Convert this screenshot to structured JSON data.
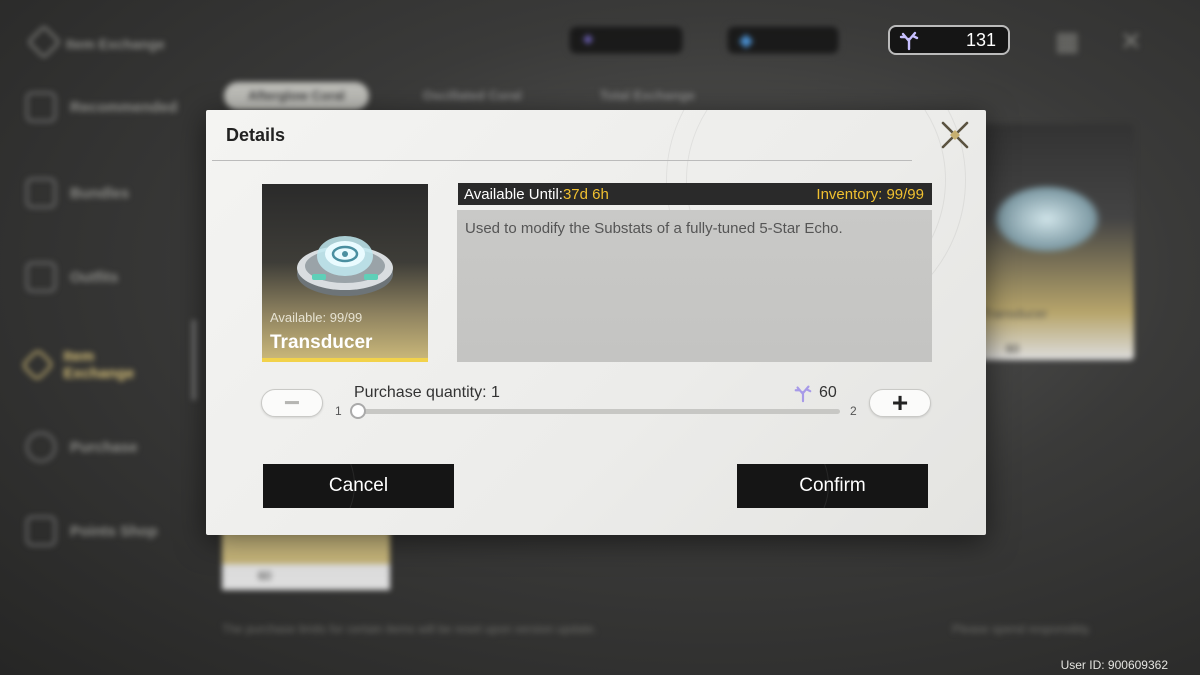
{
  "background": {
    "title": "Item Exchange",
    "sidebar": [
      {
        "label": "Recommended"
      },
      {
        "label": "Bundles"
      },
      {
        "label": "Outfits"
      },
      {
        "label": "Item Exchange"
      },
      {
        "label": "Purchase"
      },
      {
        "label": "Points Shop"
      }
    ],
    "tabs": [
      "Afterglow Coral",
      "Oscillated Coral",
      "Total Exchange"
    ],
    "currencies": [
      {
        "value": "131",
        "icon": "afterglow-coral-icon"
      }
    ],
    "card_left_price": "60",
    "card_right_label": "Transducer",
    "card_right_price": "60",
    "footnote_left": "The purchase limits for certain items will be reset upon version update.",
    "footnote_right": "Please spend responsibly."
  },
  "modal": {
    "title": "Details",
    "item": {
      "available": "Available: 99/99",
      "name": "Transducer"
    },
    "available_until_label": "Available Until:",
    "available_until_value": "37d 6h",
    "inventory_label": "Inventory:",
    "inventory_value": "99/99",
    "description": "Used to modify the Substats of a fully-tuned 5-Star Echo.",
    "quantity_label": "Purchase quantity: 1",
    "cost": "60",
    "slider_min": "1",
    "slider_max": "2",
    "cancel_label": "Cancel",
    "confirm_label": "Confirm"
  },
  "user_id": "User ID: 900609362",
  "colors": {
    "accent_gold": "#f0c030",
    "button_dark": "#151515",
    "modal_bg": "#f0f0ee"
  }
}
